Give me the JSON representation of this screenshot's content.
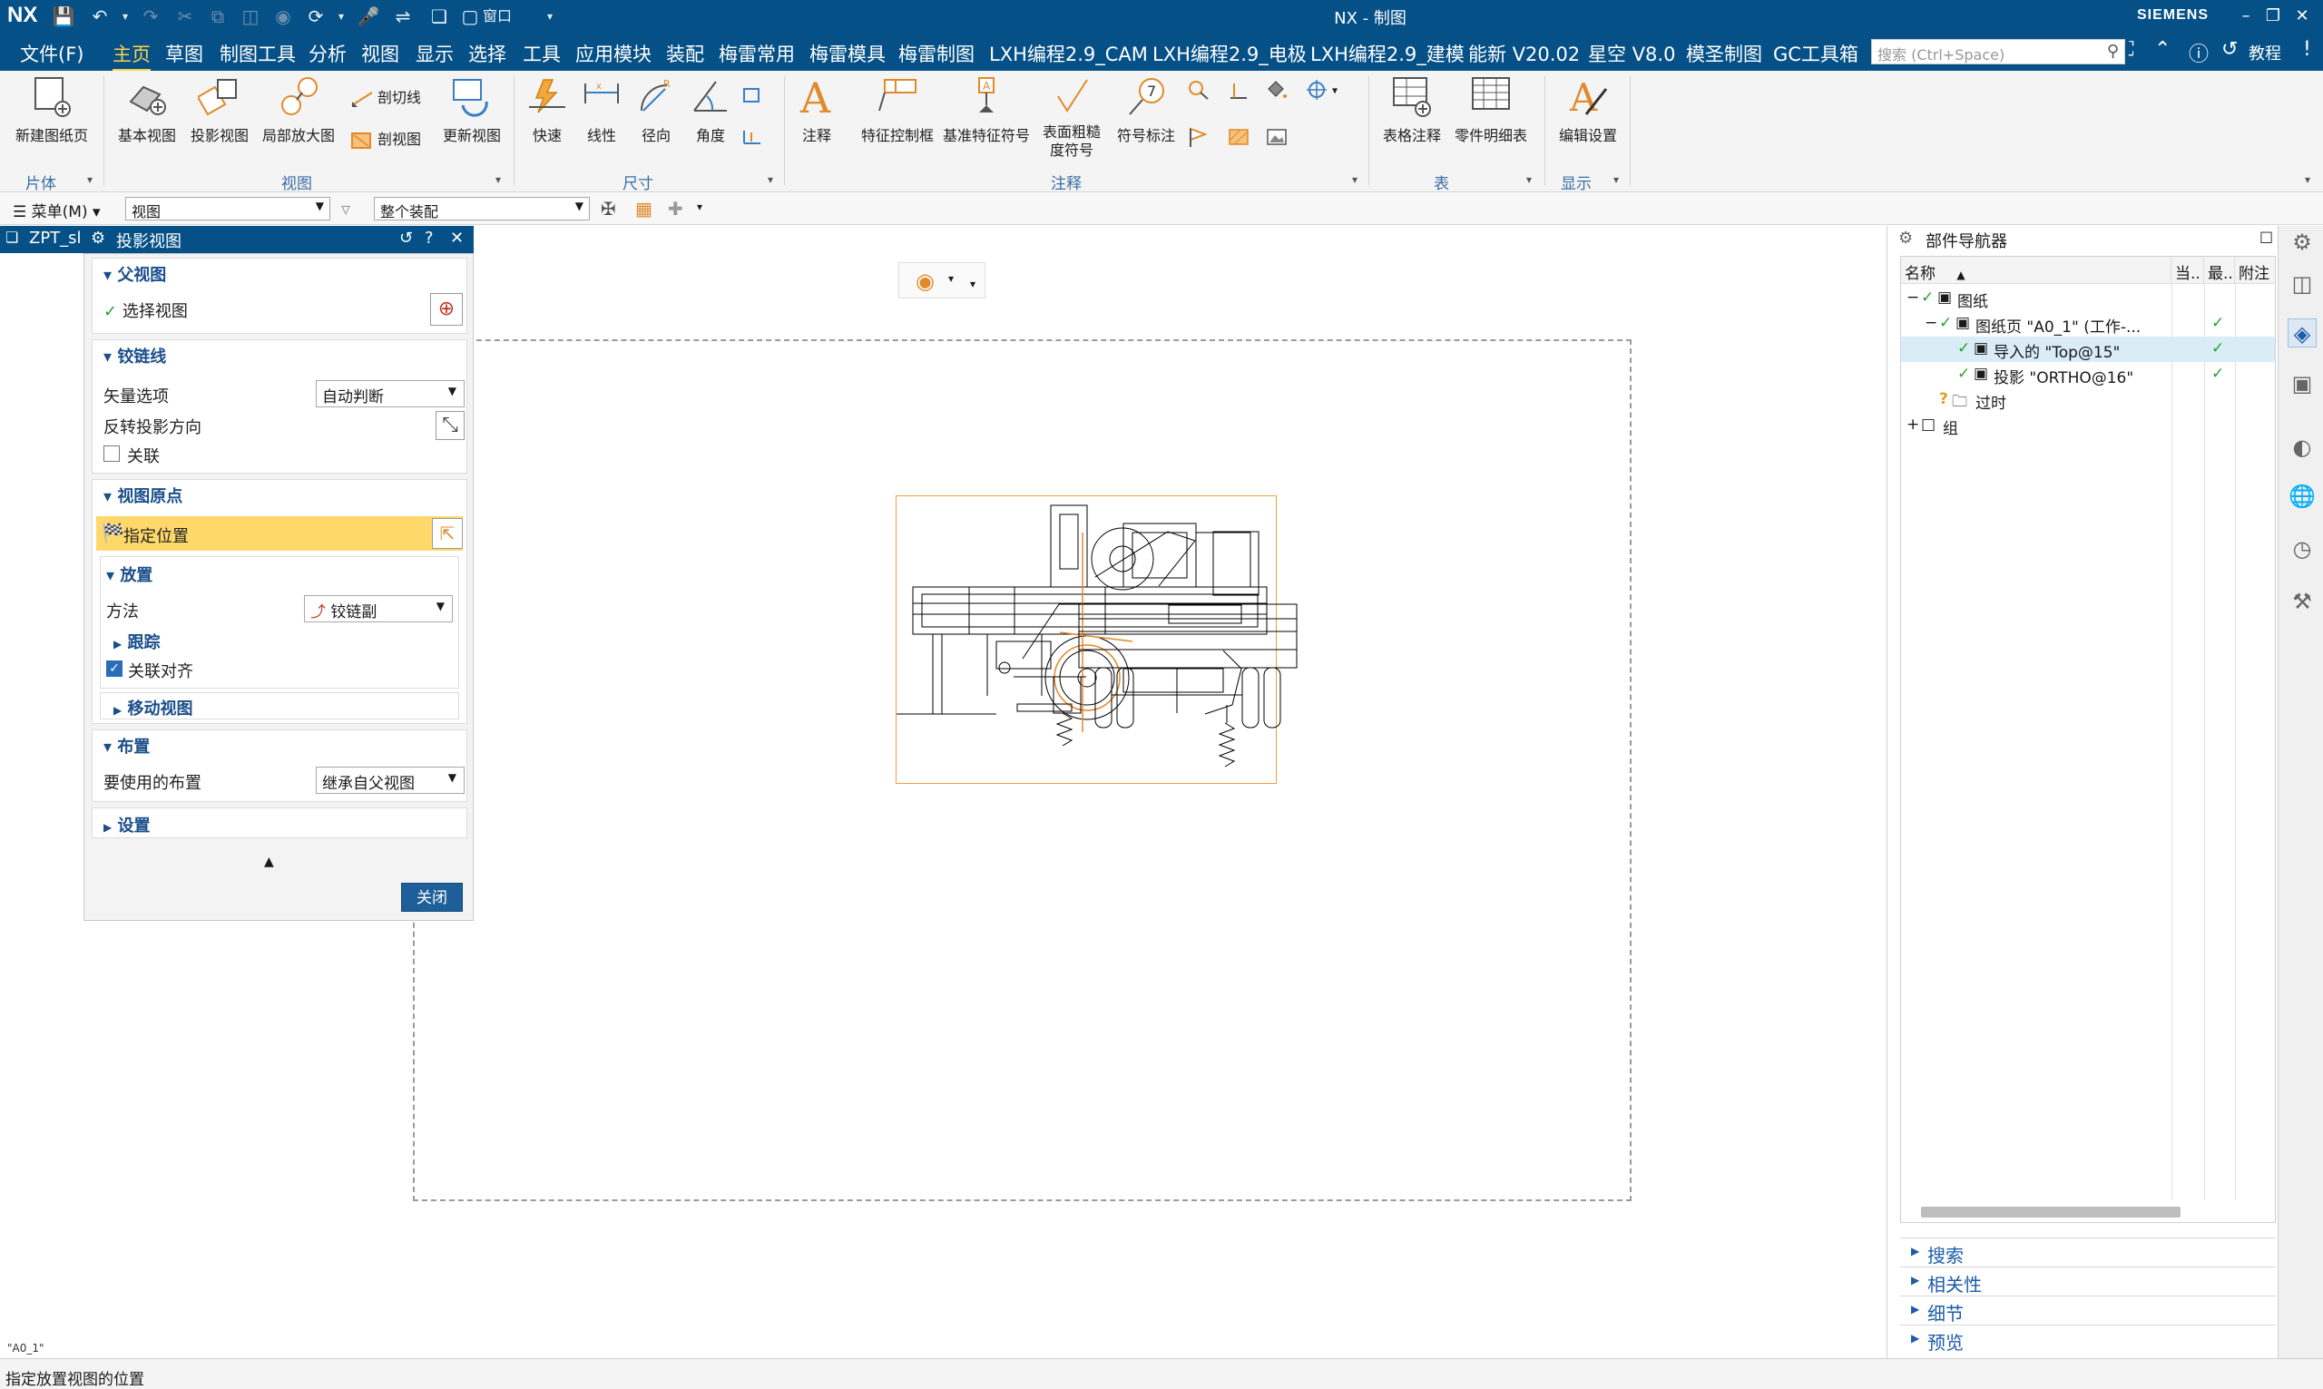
{
  "titlebar": {
    "logo": "NX",
    "title": "NX - 制图",
    "brand": "SIEMENS",
    "window_menu": "窗口"
  },
  "menubar": {
    "items": [
      "文件(F)",
      "主页",
      "草图",
      "制图工具",
      "分析",
      "视图",
      "显示",
      "选择",
      "工具",
      "应用模块",
      "装配",
      "梅雷常用",
      "梅雷模具",
      "梅雷制图",
      "LXH编程2.9_CAM",
      "LXH编程2.9_电极",
      "LXH编程2.9_建模",
      "能新 V20.02",
      "星空 V8.0",
      "模圣制图",
      "GC工具箱"
    ],
    "active": "主页",
    "search_placeholder": "搜索 (Ctrl+Space)",
    "tutorial": "教程"
  },
  "ribbon": {
    "sheet_group": {
      "new_sheet": "新建图纸页",
      "label": "片体"
    },
    "view_group": {
      "base_view": "基本视图",
      "projected_view": "投影视图",
      "detail_view": "局部放大图",
      "section_line": "剖切线",
      "section_view": "剖视图",
      "update_view": "更新视图",
      "label": "视图"
    },
    "dim_group": {
      "rapid": "快速",
      "linear": "线性",
      "radial": "径向",
      "angular": "角度",
      "label": "尺寸"
    },
    "anno_group": {
      "note": "注释",
      "fcf": "特征控制框",
      "datum": "基准特征符号",
      "surface": "表面粗糙度符号",
      "symbol": "符号标注",
      "label": "注释"
    },
    "table_group": {
      "tabular_note": "表格注释",
      "parts_list": "零件明细表",
      "label": "表"
    },
    "display_group": {
      "edit_settings": "编辑设置",
      "label": "显示"
    }
  },
  "selbar": {
    "menu": "菜单(M)",
    "filter": "视图",
    "scope": "整个装配"
  },
  "dialog": {
    "tab_part": "ZPT_sl",
    "title": "投影视图",
    "parent_view": {
      "header": "父视图",
      "select_view": "选择视图"
    },
    "hinge_line": {
      "header": "铰链线",
      "vector_option_label": "矢量选项",
      "vector_option_value": "自动判断",
      "reverse_label": "反转投影方向",
      "associative_label": "关联"
    },
    "view_origin": {
      "header": "视图原点",
      "specify_location": "指定位置",
      "placement_header": "放置",
      "method_label": "方法",
      "method_value": "铰链副",
      "tracking": "跟踪",
      "assoc_align": "关联对齐",
      "move_view": "移动视图"
    },
    "layout": {
      "header": "布置",
      "layout_label": "要使用的布置",
      "layout_value": "继承自父视图"
    },
    "settings_header": "设置",
    "close_button": "关闭"
  },
  "navigator": {
    "title": "部件导航器",
    "columns": [
      "名称",
      "当..",
      "最..",
      "附注"
    ],
    "rows": [
      {
        "indent": 0,
        "expander": "−",
        "label": "图纸",
        "check": true,
        "current": false,
        "latest": false
      },
      {
        "indent": 1,
        "expander": "−",
        "label": "图纸页 \"A0_1\" (工作-...",
        "check": true,
        "current": false,
        "latest": true
      },
      {
        "indent": 2,
        "expander": "",
        "label": "导入的 \"Top@15\"",
        "check": true,
        "current": false,
        "latest": true
      },
      {
        "indent": 2,
        "expander": "",
        "label": "投影 \"ORTHO@16\"",
        "check": true,
        "current": false,
        "latest": true
      },
      {
        "indent": 1,
        "expander": "",
        "label": "过时",
        "check": false,
        "current": false,
        "latest": false
      },
      {
        "indent": 0,
        "expander": "+",
        "label": "组",
        "check": false,
        "current": false,
        "latest": false
      }
    ],
    "sections": [
      "搜索",
      "相关性",
      "细节",
      "预览"
    ]
  },
  "graphics": {
    "sheet_label": "\"A0_1\""
  },
  "status": {
    "prompt": "指定放置视图的位置"
  },
  "colors": {
    "titlebar": "#055086",
    "accent": "#ffd24a",
    "highlight": "#ffd86b",
    "selection": "#f0a040"
  }
}
